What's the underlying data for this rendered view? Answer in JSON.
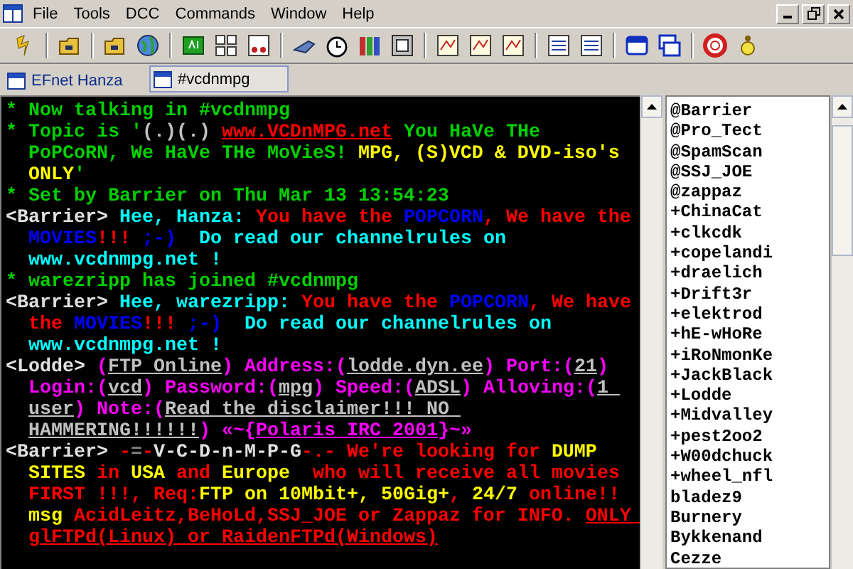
{
  "menu": [
    {
      "label": "File"
    },
    {
      "label": "Tools"
    },
    {
      "label": "DCC"
    },
    {
      "label": "Commands"
    },
    {
      "label": "Window"
    },
    {
      "label": "Help"
    }
  ],
  "tabs": [
    {
      "label": "EFnet Hanza",
      "selected": false
    },
    {
      "label": "#vcdnmpg",
      "selected": true
    }
  ],
  "chat": [
    {
      "segments": [
        {
          "text": "* Now talking in #vcdnmpg",
          "color": "#00d000",
          "underlined": false
        }
      ]
    },
    {
      "segments": [
        {
          "text": "* Topic is '",
          "color": "#00d000",
          "underlined": false
        },
        {
          "text": "(.)(.) ",
          "color": "#c0c0c0",
          "underlined": false
        },
        {
          "text": "www.VCDnMPG.net",
          "color": "#ff0000",
          "underlined": true
        },
        {
          "text": " You HaVe THe PoPCoRN, We HaVe THe MoVieS!",
          "color": "#00d000",
          "underlined": false
        },
        {
          "text": " MPG, (S)VCD & DVD-iso's ONLY",
          "color": "#ffff00",
          "underlined": false
        },
        {
          "text": "'",
          "color": "#00d000",
          "underlined": false
        }
      ]
    },
    {
      "segments": [
        {
          "text": "* Set by Barrier on Thu Mar 13 13:54:23",
          "color": "#00d000",
          "underlined": false
        }
      ]
    },
    {
      "segments": [
        {
          "text": "<Barrier> ",
          "color": "#e0e0e0",
          "underlined": false
        },
        {
          "text": "Hee, Hanza: ",
          "color": "#00ffff",
          "underlined": false
        },
        {
          "text": "You have the ",
          "color": "#ff0000",
          "underlined": false
        },
        {
          "text": "POPCORN",
          "color": "#0000ff",
          "underlined": false
        },
        {
          "text": ", We have the ",
          "color": "#ff0000",
          "underlined": false
        },
        {
          "text": "MOVIES",
          "color": "#0000ff",
          "underlined": false
        },
        {
          "text": "!!! ",
          "color": "#ff0000",
          "underlined": false
        },
        {
          "text": ";-)",
          "color": "#0000ff",
          "underlined": false
        },
        {
          "text": "  Do read our channelrules on www.vcdnmpg.net !",
          "color": "#00ffff",
          "underlined": false
        }
      ]
    },
    {
      "segments": [
        {
          "text": "* warezripp has joined #vcdnmpg",
          "color": "#00d000",
          "underlined": false
        }
      ]
    },
    {
      "segments": [
        {
          "text": "<Barrier> ",
          "color": "#e0e0e0",
          "underlined": false
        },
        {
          "text": "Hee, warezripp: ",
          "color": "#00ffff",
          "underlined": false
        },
        {
          "text": "You have the ",
          "color": "#ff0000",
          "underlined": false
        },
        {
          "text": "POPCORN",
          "color": "#0000ff",
          "underlined": false
        },
        {
          "text": ", We have the ",
          "color": "#ff0000",
          "underlined": false
        },
        {
          "text": "MOVIES",
          "color": "#0000ff",
          "underlined": false
        },
        {
          "text": "!!! ",
          "color": "#ff0000",
          "underlined": false
        },
        {
          "text": ";-)",
          "color": "#0000ff",
          "underlined": false
        },
        {
          "text": "  Do read our channelrules on www.vcdnmpg.net !",
          "color": "#00ffff",
          "underlined": false
        }
      ]
    },
    {
      "segments": [
        {
          "text": "<Lodde> ",
          "color": "#e0e0e0",
          "underlined": false
        },
        {
          "text": "(",
          "color": "#ff00ff",
          "underlined": false
        },
        {
          "text": "FTP Online",
          "color": "#c0c0c0",
          "underlined": true
        },
        {
          "text": ") Address:(",
          "color": "#ff00ff",
          "underlined": false
        },
        {
          "text": "lodde.dyn.ee",
          "color": "#c0c0c0",
          "underlined": true
        },
        {
          "text": ") Port:(",
          "color": "#ff00ff",
          "underlined": false
        },
        {
          "text": "21",
          "color": "#c0c0c0",
          "underlined": true
        },
        {
          "text": ") Login:(",
          "color": "#ff00ff",
          "underlined": false
        },
        {
          "text": "vcd",
          "color": "#c0c0c0",
          "underlined": true
        },
        {
          "text": ") Password:(",
          "color": "#ff00ff",
          "underlined": false
        },
        {
          "text": "mpg",
          "color": "#c0c0c0",
          "underlined": true
        },
        {
          "text": ") Speed:(",
          "color": "#ff00ff",
          "underlined": false
        },
        {
          "text": "ADSL",
          "color": "#c0c0c0",
          "underlined": true
        },
        {
          "text": ") Alloving:(",
          "color": "#ff00ff",
          "underlined": false
        },
        {
          "text": "1 user",
          "color": "#c0c0c0",
          "underlined": true
        },
        {
          "text": ") Note:(",
          "color": "#ff00ff",
          "underlined": false
        },
        {
          "text": "Read the disclaimer!!! NO HAMMERING!!!!!!",
          "color": "#c0c0c0",
          "underlined": true
        },
        {
          "text": ") «~{",
          "color": "#ff00ff",
          "underlined": false
        },
        {
          "text": "Polaris IRC 2001",
          "color": "#ff00ff",
          "underlined": true
        },
        {
          "text": "}~»",
          "color": "#ff00ff",
          "underlined": false
        }
      ]
    },
    {
      "segments": [
        {
          "text": "<Barrier> ",
          "color": "#e0e0e0",
          "underlined": false
        },
        {
          "text": "-",
          "color": "#ff0000",
          "underlined": false
        },
        {
          "text": "=",
          "color": "#808080",
          "underlined": false
        },
        {
          "text": "-",
          "color": "#ff0000",
          "underlined": false
        },
        {
          "text": "V-C-D-n-M-P-G",
          "color": "#e0e0e0",
          "underlined": false
        },
        {
          "text": "-.-",
          "color": "#ff0000",
          "underlined": false
        },
        {
          "text": " We're looking for ",
          "color": "#ff0000",
          "underlined": false
        },
        {
          "text": "DUMP SITES",
          "color": "#ffff00",
          "underlined": false
        },
        {
          "text": " in ",
          "color": "#ff0000",
          "underlined": false
        },
        {
          "text": "USA",
          "color": "#ffff00",
          "underlined": false
        },
        {
          "text": " and ",
          "color": "#ff0000",
          "underlined": false
        },
        {
          "text": "Europe",
          "color": "#ffff00",
          "underlined": false
        },
        {
          "text": "  who will receive all movies FIRST !!!, Req:",
          "color": "#ff0000",
          "underlined": false
        },
        {
          "text": "FTP on 10Mbit+, 50Gig+",
          "color": "#ffff00",
          "underlined": false
        },
        {
          "text": ", ",
          "color": "#ff0000",
          "underlined": false
        },
        {
          "text": "24/7",
          "color": "#ffff00",
          "underlined": false
        },
        {
          "text": " online!! ",
          "color": "#ff0000",
          "underlined": false
        },
        {
          "text": "msg",
          "color": "#ffff00",
          "underlined": false
        },
        {
          "text": " AcidLeitz,BeHoLd,SSJ_JOE or Zappaz for INFO. ",
          "color": "#ff0000",
          "underlined": false
        },
        {
          "text": "ONLY glFTPd(Linux) or RaidenFTPd(Windows)",
          "color": "#ff0000",
          "underlined": true
        }
      ]
    }
  ],
  "nicklist": [
    "@Barrier",
    "@Pro_Tect",
    "@SpamScan",
    "@SSJ_JOE",
    "@zappaz",
    "+ChinaCat",
    "+clkcdk",
    "+copelandi",
    "+draelich",
    "+Drift3r",
    "+elektrod",
    "+hE-wHoRe",
    "+iRoNmonKe",
    "+JackBlack",
    "+Lodde",
    "+Midvalley",
    "+pest2oo2",
    "+W00dchuck",
    "+wheel_nfl",
    "bladez9",
    "Burnery",
    "Bykkenand",
    "Cezze"
  ]
}
